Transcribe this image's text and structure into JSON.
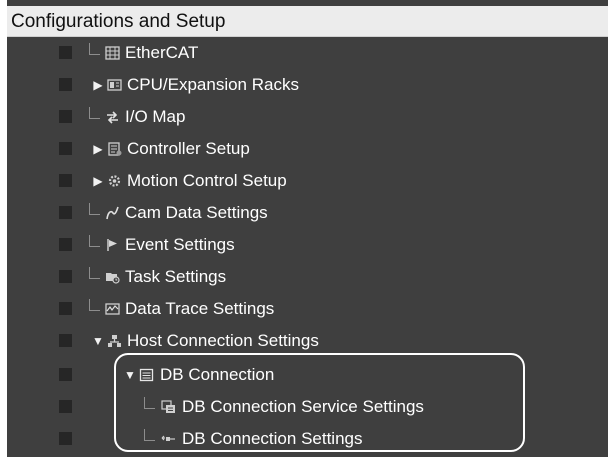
{
  "header": {
    "title": "Configurations and Setup",
    "expand_icon": "triangle-down-icon"
  },
  "items": [
    {
      "label": "EtherCAT",
      "icon": "ethercat-icon",
      "indicator": "connector"
    },
    {
      "label": "CPU/Expansion Racks",
      "icon": "racks-icon",
      "indicator": "collapsed"
    },
    {
      "label": "I/O Map",
      "icon": "io-map-icon",
      "indicator": "connector"
    },
    {
      "label": "Controller Setup",
      "icon": "controller-setup-icon",
      "indicator": "collapsed"
    },
    {
      "label": "Motion Control Setup",
      "icon": "gear-icon",
      "indicator": "collapsed"
    },
    {
      "label": "Cam Data Settings",
      "icon": "cam-curve-icon",
      "indicator": "connector"
    },
    {
      "label": "Event Settings",
      "icon": "flag-icon",
      "indicator": "connector"
    },
    {
      "label": "Task Settings",
      "icon": "task-icon",
      "indicator": "connector"
    },
    {
      "label": "Data Trace Settings",
      "icon": "trace-icon",
      "indicator": "connector"
    },
    {
      "label": "Host Connection Settings",
      "icon": "host-connection-icon",
      "indicator": "expanded"
    },
    {
      "label": "DB Connection",
      "icon": "list-icon",
      "indicator": "expanded"
    },
    {
      "label": "DB Connection Service Settings",
      "icon": "service-settings-icon",
      "indicator": "connector"
    },
    {
      "label": "DB Connection Settings",
      "icon": "db-link-icon",
      "indicator": "connector"
    }
  ]
}
